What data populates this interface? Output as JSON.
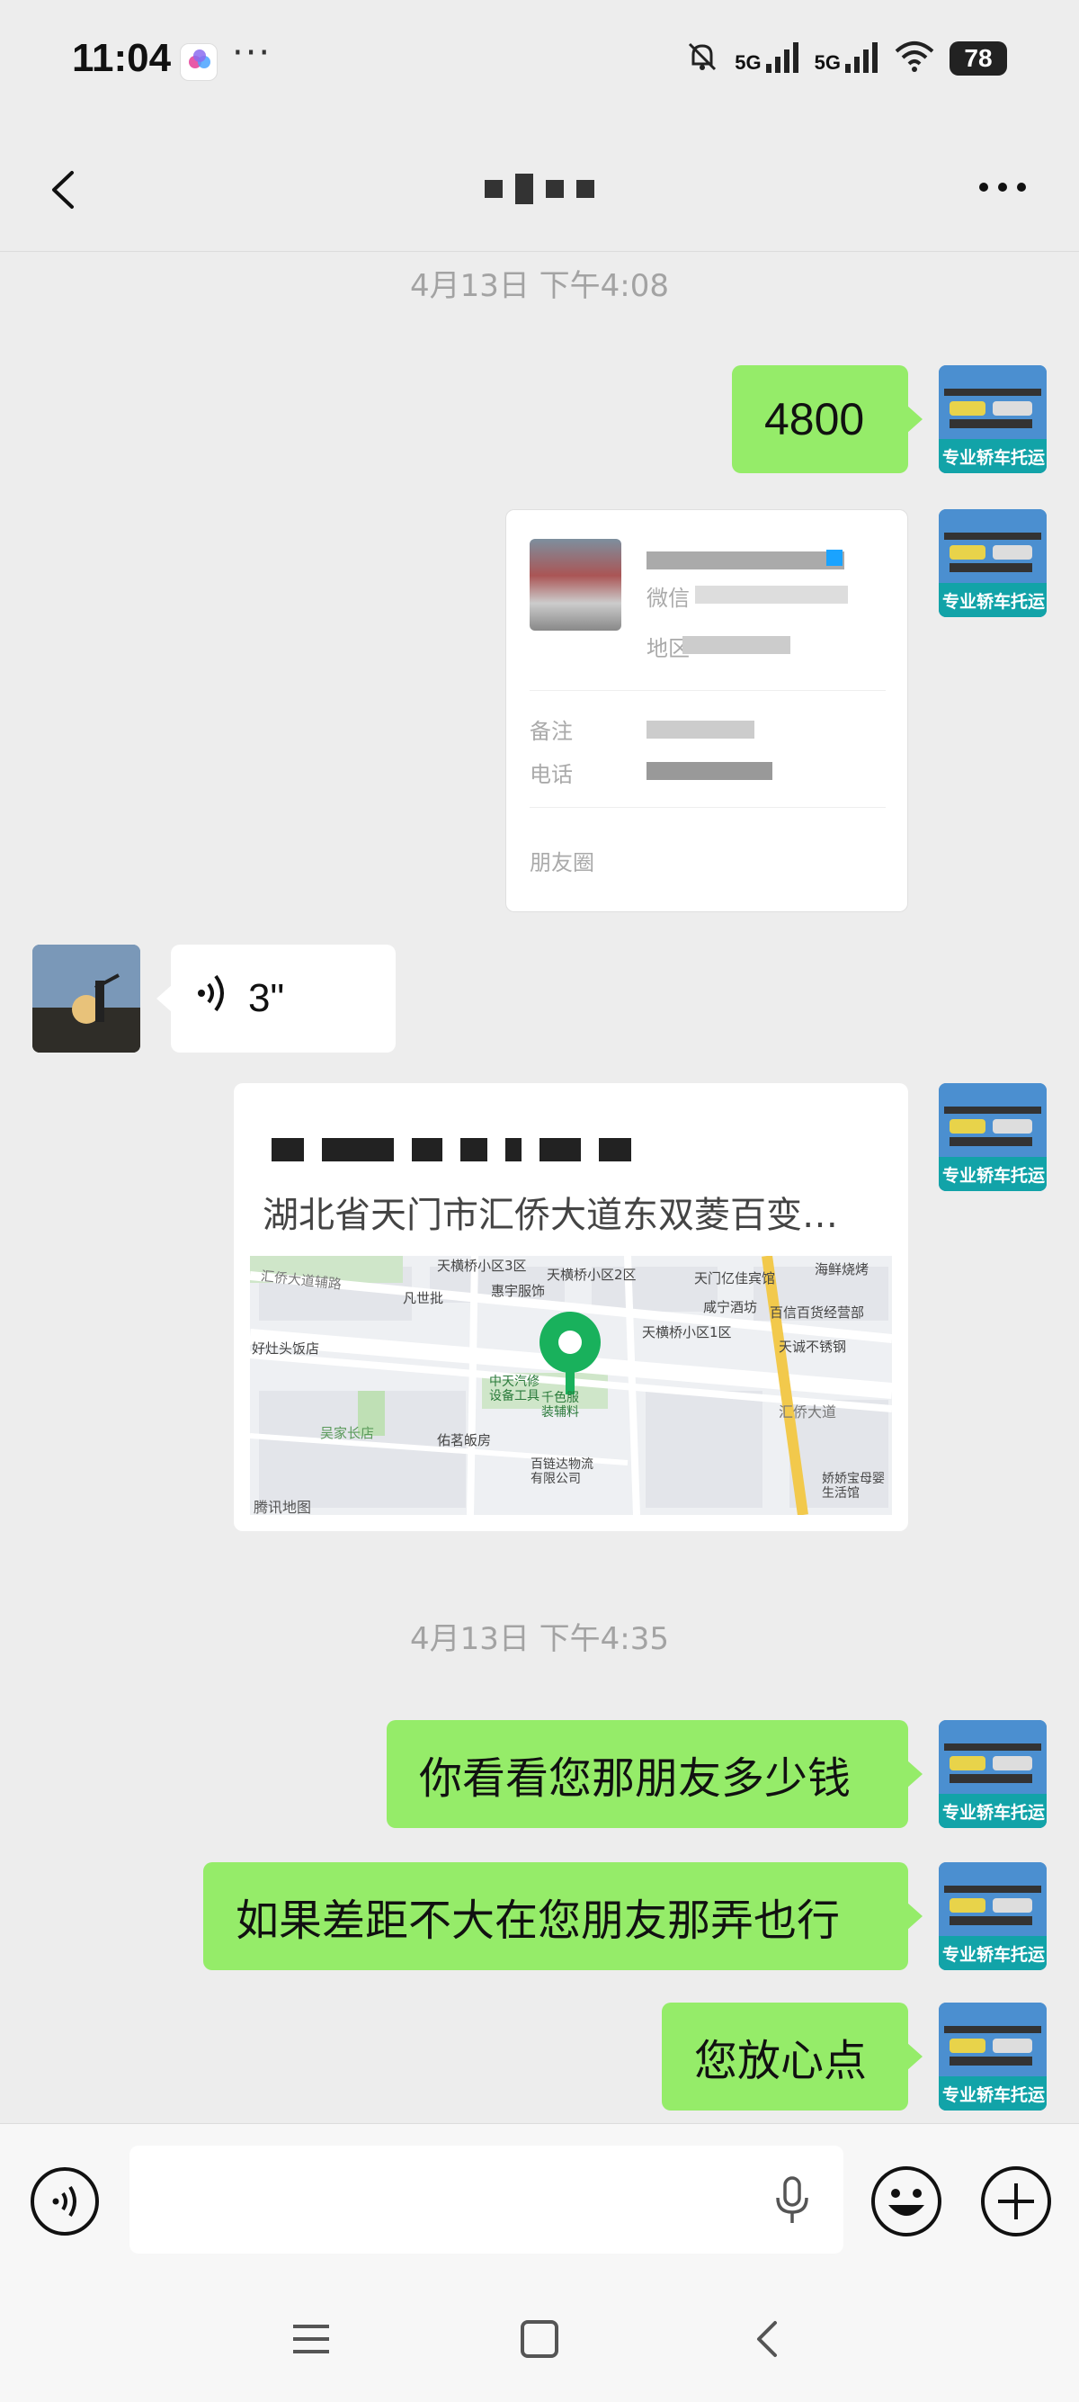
{
  "status_bar": {
    "time": "11:04",
    "app_icon": "cloud-app-icon",
    "more": "···",
    "icons": [
      "mute-bell-icon",
      "signal-5g-icon",
      "signal-5g-icon",
      "wifi-icon"
    ],
    "sig1": "5G",
    "sig2": "5G",
    "battery": "78"
  },
  "nav": {
    "back_icon": "chevron-left-icon",
    "more_icon": "more-dots-icon"
  },
  "messages": {
    "ts1": "4月13日 下午4:08",
    "m1": "4800",
    "card": {
      "note_label": "备注",
      "phone_label": "电话",
      "moments_label": "朋友圈",
      "wechat_label": "微信",
      "region_label": "地区"
    },
    "voice": {
      "duration": "3\""
    },
    "location": {
      "address": "湖北省天门市汇侨大道东双菱百变…",
      "map_labels": {
        "l1": "天横桥小区3区",
        "l2": "天横桥小区2区",
        "l3": "天门亿佳宾馆",
        "l4": "海鲜烧烤",
        "l5": "汇侨大道辅路",
        "l6": "凡世批",
        "l7": "惠宇服饰",
        "l8": "咸宁酒坊",
        "l9": "百信百货经营部",
        "l10": "好灶头饭店",
        "l11": "天横桥小区1区",
        "l12": "天诚不锈钢",
        "l13": "中天汽修设备工具",
        "l14": "千色服装辅料",
        "l15": "汇侨大道",
        "l16": "吴家长店",
        "l17": "佑茗皈房",
        "l18": "百链达物流有限公司",
        "l19": "娇娇宝母婴生活馆",
        "credit": "腾讯地图"
      }
    },
    "ts2": "4月13日 下午4:35",
    "m2": "你看看您那朋友多少钱",
    "m3": "如果差距不大在您朋友那弄也行",
    "m4": "您放心点"
  },
  "avatars": {
    "me_caption": "专业轿车托运"
  },
  "input": {
    "voice_icon": "voice-mode-icon",
    "mic_icon": "mic-icon",
    "emoji_icon": "emoji-icon",
    "plus_icon": "plus-icon"
  },
  "system_nav": [
    "menu-icon",
    "home-square-icon",
    "back-icon"
  ],
  "colors": {
    "bubble_me": "#95ec69",
    "bubble_other": "#ffffff",
    "background": "#ededed",
    "map_pin": "#19b15c"
  }
}
